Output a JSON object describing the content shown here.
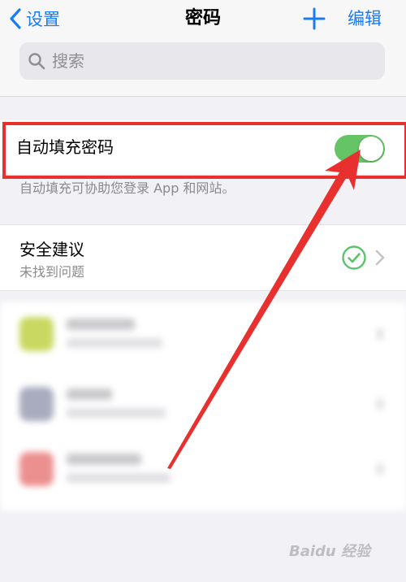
{
  "nav": {
    "back_label": "设置",
    "title": "密码",
    "edit_label": "编辑"
  },
  "search": {
    "placeholder": "搜索"
  },
  "autofill": {
    "label": "自动填充密码",
    "enabled": true,
    "footnote": "自动填充可协助您登录 App 和网站。"
  },
  "security": {
    "title": "安全建议",
    "subtitle": "未找到问题"
  },
  "watermark": "Baidu 经验",
  "colors": {
    "accent": "#1a7cf2",
    "toggle_on": "#65c466",
    "check": "#5cc36b",
    "annotation": "#e8302e"
  },
  "icons": [
    "chevron-left-icon",
    "plus-icon",
    "search-icon",
    "checkmark-circle-icon",
    "chevron-right-icon"
  ]
}
